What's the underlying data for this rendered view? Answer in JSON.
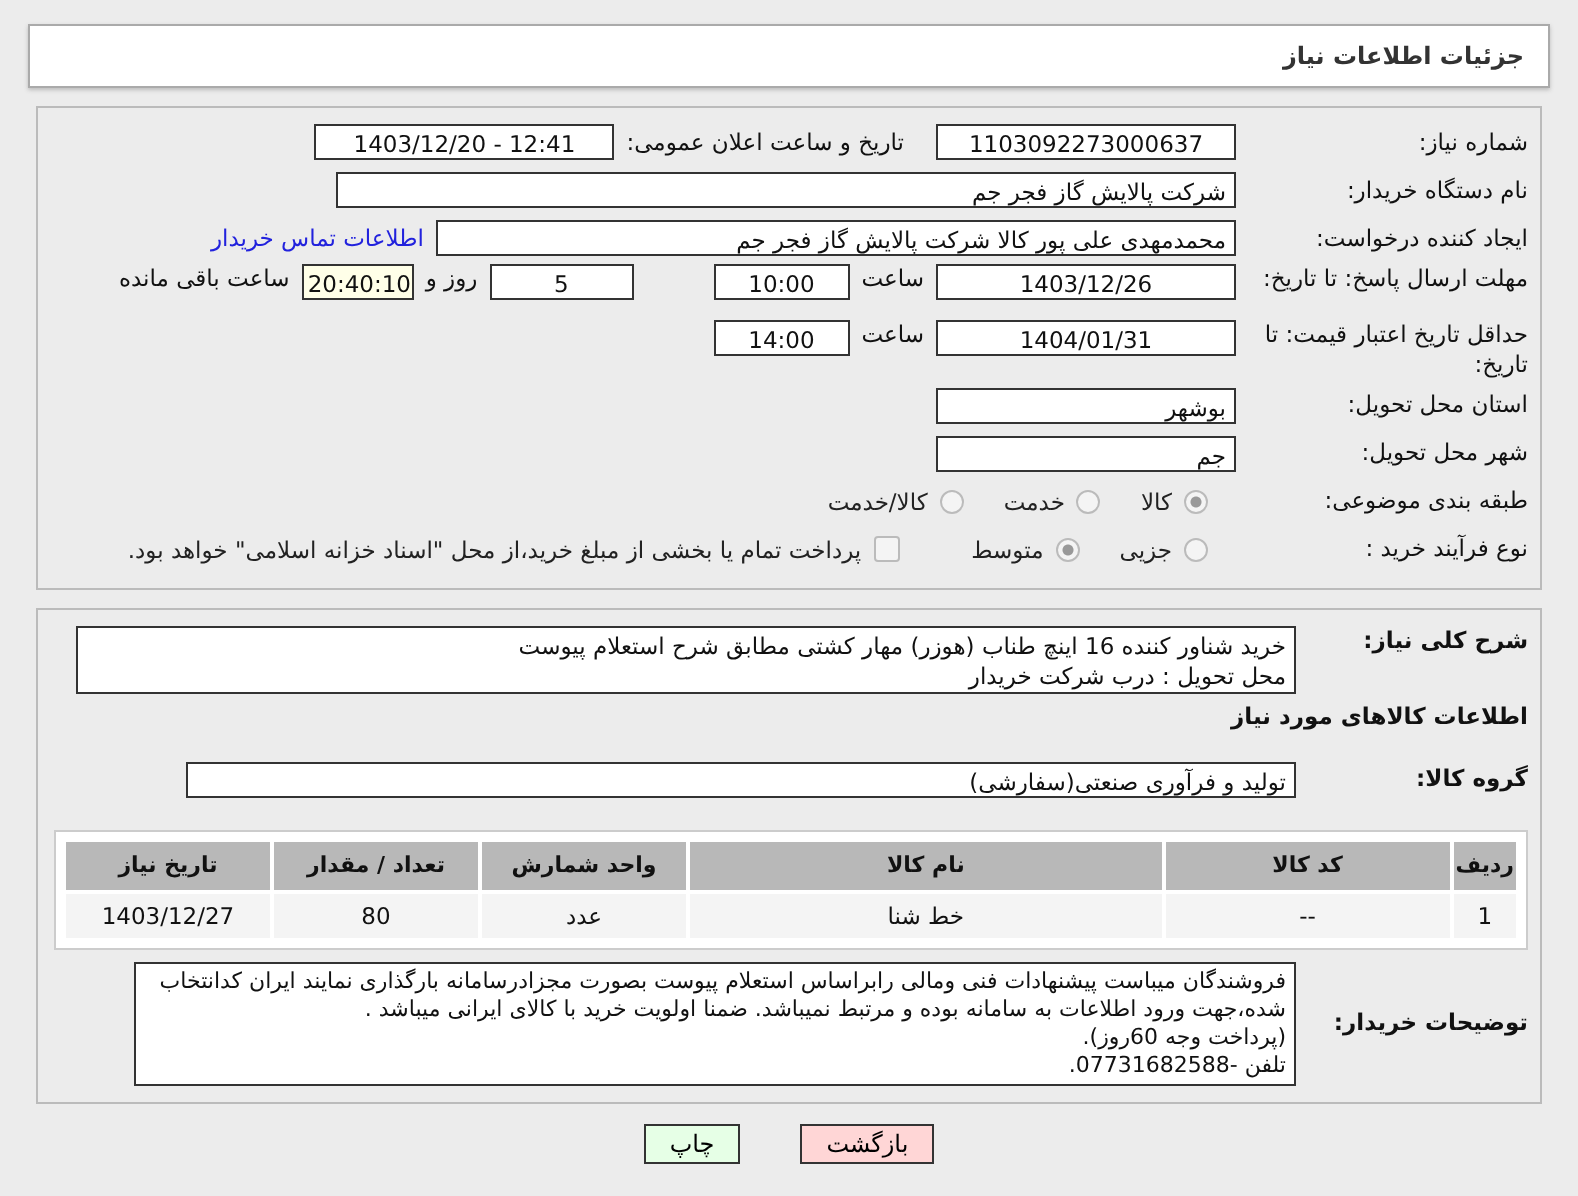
{
  "page_title": "جزئیات اطلاعات نیاز",
  "need_number": {
    "label": "شماره نیاز:",
    "value": "1103092273000637"
  },
  "announce_datetime": {
    "label": "تاریخ و ساعت اعلان عمومی:",
    "value": "1403/12/20 - 12:41"
  },
  "buyer_org": {
    "label": "نام دستگاه خریدار:",
    "value": "شرکت پالایش گاز فجر جم"
  },
  "requester": {
    "label": "ایجاد کننده درخواست:",
    "value": "محمدمهدی علی پور کالا شرکت پالایش گاز فجر جم",
    "link": "اطلاعات تماس خریدار"
  },
  "response_deadline": {
    "label": "مهلت ارسال پاسخ: تا تاریخ:",
    "date": "1403/12/26",
    "time_label": "ساعت",
    "time": "10:00",
    "days": "5",
    "days_label": "روز و",
    "remaining": "20:40:10",
    "remaining_label": "ساعت باقی مانده"
  },
  "price_validity": {
    "label": "حداقل تاریخ اعتبار قیمت: تا تاریخ:",
    "date": "1404/01/31",
    "time_label": "ساعت",
    "time": "14:00"
  },
  "province": {
    "label": "استان محل تحویل:",
    "value": "بوشهر"
  },
  "city": {
    "label": "شهر محل تحویل:",
    "value": "جم"
  },
  "category": {
    "label": "طبقه بندی موضوعی:",
    "options": [
      {
        "label": "کالا",
        "selected": true
      },
      {
        "label": "خدمت",
        "selected": false
      },
      {
        "label": "کالا/خدمت",
        "selected": false
      }
    ]
  },
  "process": {
    "label": "نوع فرآیند خرید :",
    "options": [
      {
        "label": "جزیی",
        "selected": false
      },
      {
        "label": "متوسط",
        "selected": true
      }
    ],
    "payment_option": {
      "label": "پرداخت تمام یا بخشی از مبلغ خرید،از محل \"اسناد خزانه اسلامی\" خواهد بود.",
      "checked": false
    }
  },
  "description": {
    "label": "شرح کلی نیاز:",
    "lines": [
      "خرید شناور کننده 16 اینچ طناب (هوزر) مهار کشتی مطابق شرح استعلام پیوست",
      "محل تحویل : درب شرکت خریدار"
    ]
  },
  "goods_section_title": "اطلاعات کالاهای مورد نیاز",
  "goods_group": {
    "label": "گروه کالا:",
    "value": "تولید و فرآوری صنعتی(سفارشی)"
  },
  "table": {
    "columns": [
      "ردیف",
      "کد کالا",
      "نام کالا",
      "واحد شمارش",
      "تعداد / مقدار",
      "تاریخ نیاز"
    ],
    "rows": [
      [
        "1",
        "--",
        "خط شنا",
        "عدد",
        "80",
        "1403/12/27"
      ]
    ]
  },
  "buyer_notes": {
    "label": "توضیحات خریدار:",
    "lines": [
      " فروشندگان میباست پیشنهادات فنی ومالی رابراساس استعلام پیوست بصورت مجزادرسامانه بارگذاری نمایند ایران کدانتخاب شده،جهت ورود اطلاعات به سامانه بوده و مرتبط نمیباشد. ضمنا اولویت خرید با کالای ایرانی میباشد .",
      "(پرداخت وجه 60روز).",
      "تلفن -07731682588."
    ]
  },
  "buttons": [
    {
      "label": "بازگشت",
      "kind": "back"
    },
    {
      "label": "چاپ",
      "kind": "print"
    }
  ]
}
